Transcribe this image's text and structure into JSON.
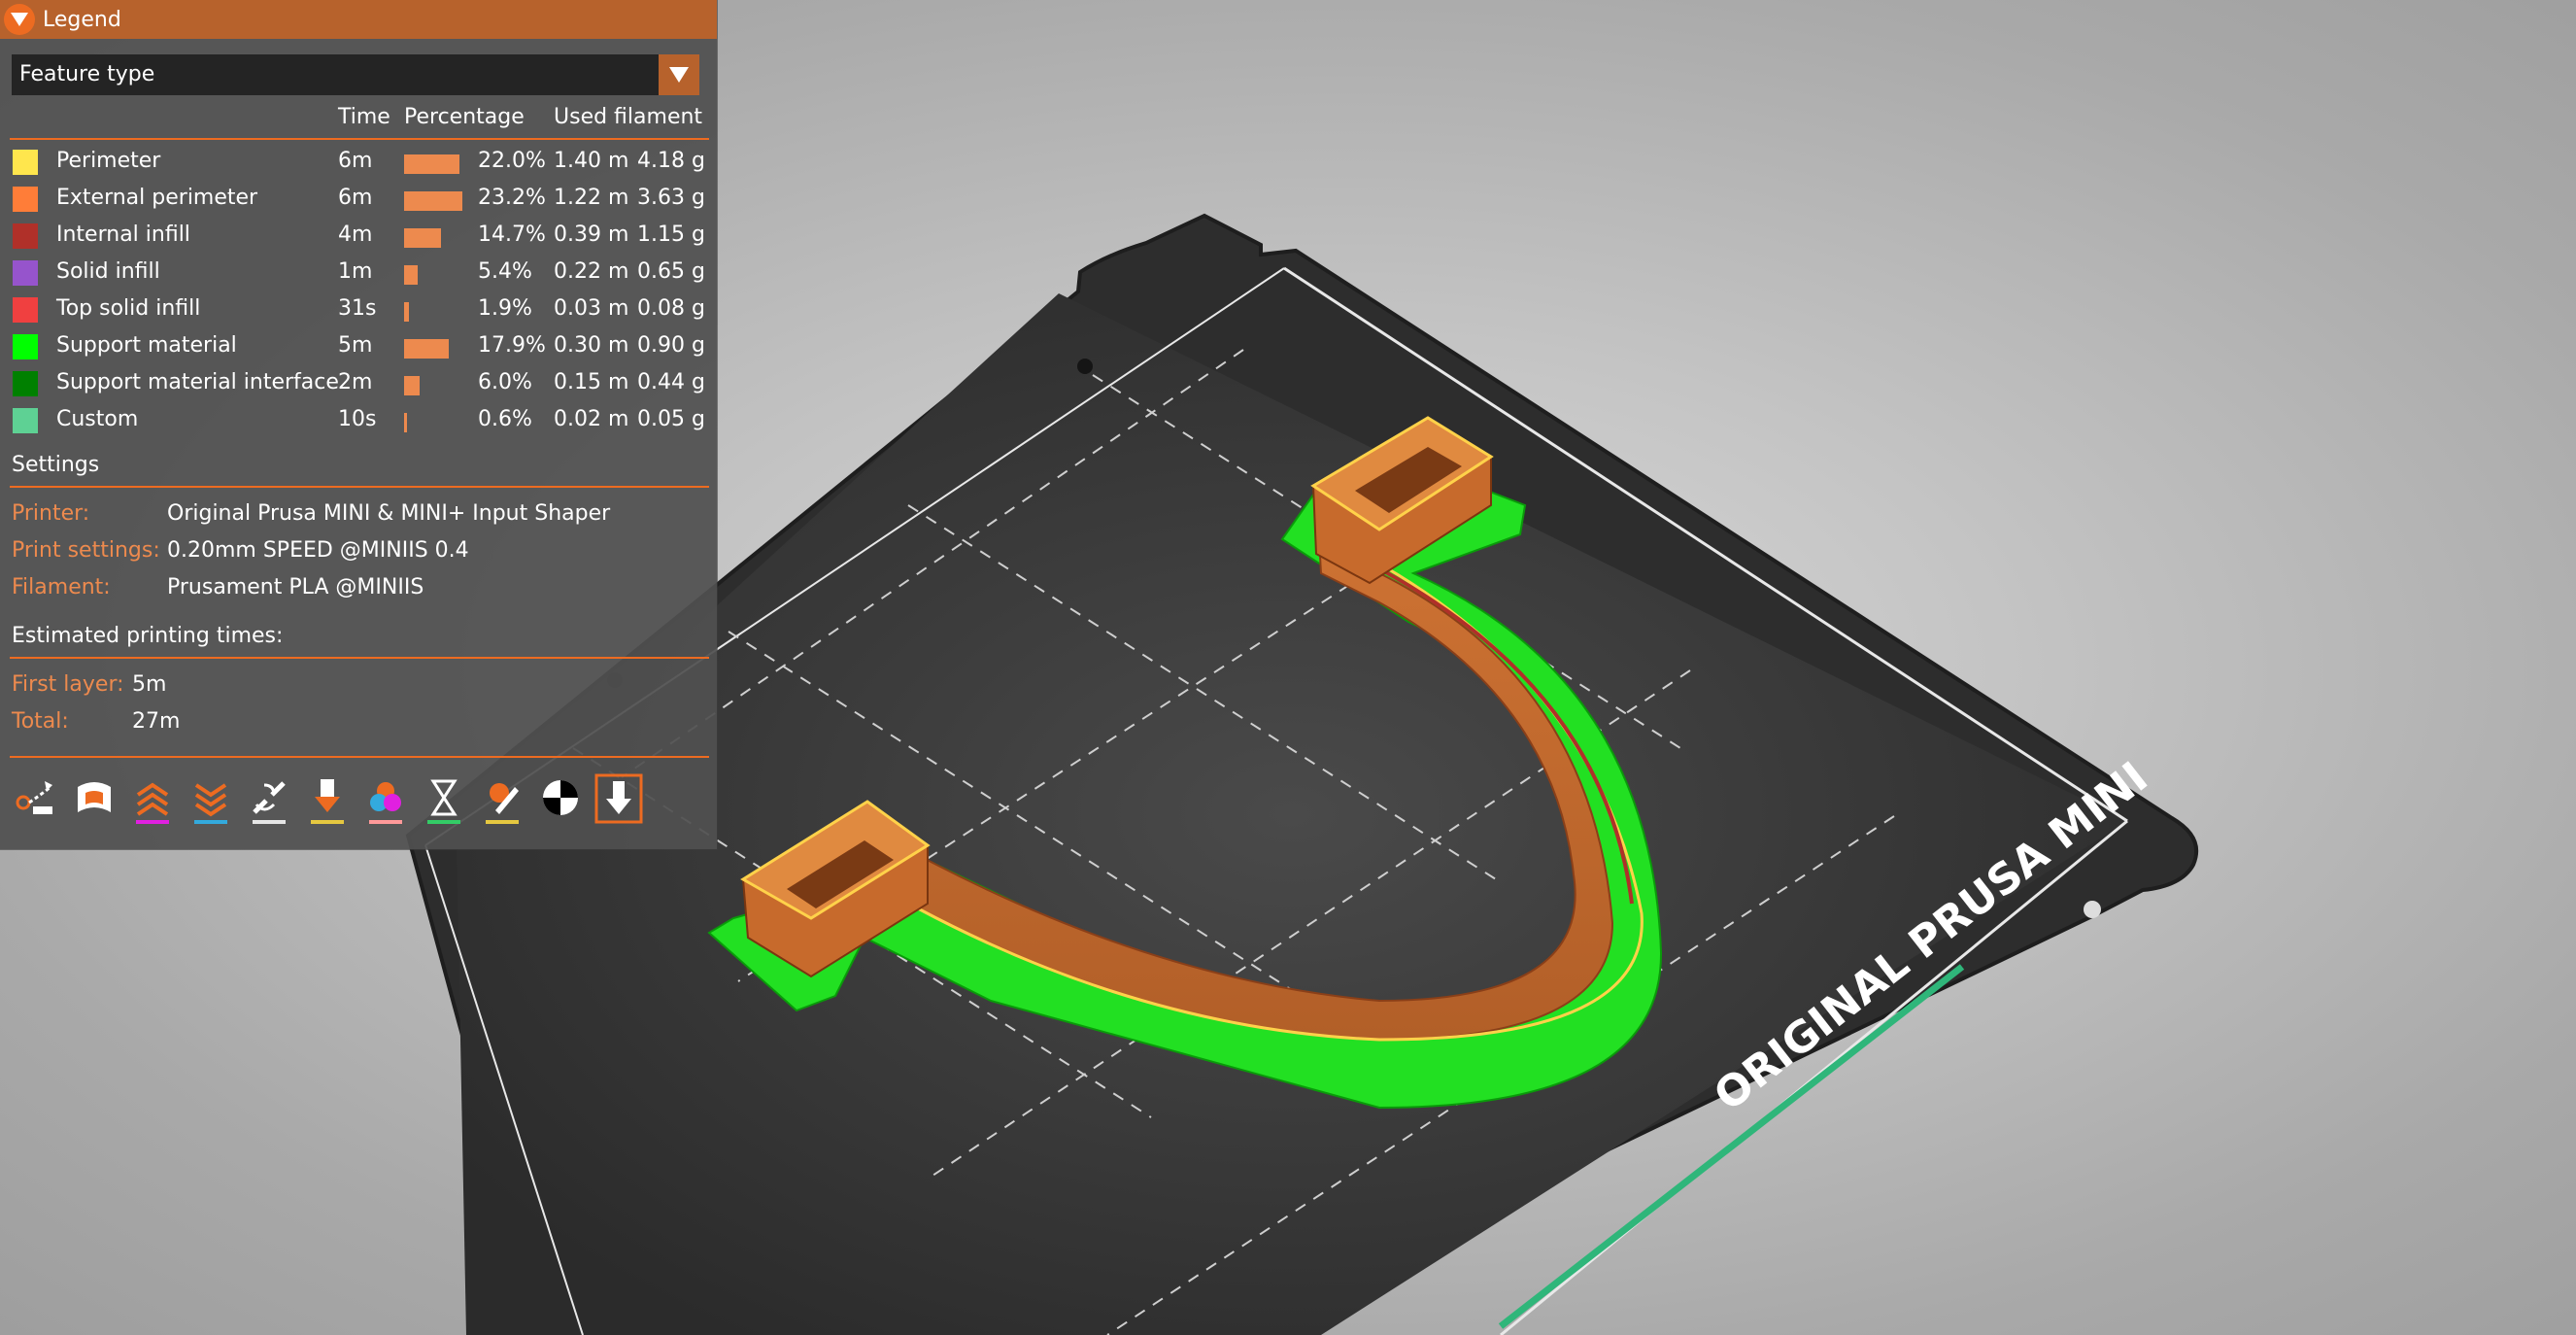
{
  "legend": {
    "title": "Legend",
    "view_type": "Feature type",
    "columns": {
      "time": "Time",
      "percentage": "Percentage",
      "used_filament": "Used filament"
    },
    "features": [
      {
        "name": "Perimeter",
        "time": "6m",
        "percentage": "22.0%",
        "length": "1.40 m",
        "weight": "4.18 g",
        "color": "#ffe64d",
        "fraction": 0.22
      },
      {
        "name": "External perimeter",
        "time": "6m",
        "percentage": "23.2%",
        "length": "1.22 m",
        "weight": "3.63 g",
        "color": "#ff7d38",
        "fraction": 0.232
      },
      {
        "name": "Internal infill",
        "time": "4m",
        "percentage": "14.7%",
        "length": "0.39 m",
        "weight": "1.15 g",
        "color": "#b03029",
        "fraction": 0.147
      },
      {
        "name": "Solid infill",
        "time": "1m",
        "percentage": "5.4%",
        "length": "0.22 m",
        "weight": "0.65 g",
        "color": "#9654cc",
        "fraction": 0.054
      },
      {
        "name": "Top solid infill",
        "time": "31s",
        "percentage": "1.9%",
        "length": "0.03 m",
        "weight": "0.08 g",
        "color": "#f04040",
        "fraction": 0.019
      },
      {
        "name": "Support material",
        "time": "5m",
        "percentage": "17.9%",
        "length": "0.30 m",
        "weight": "0.90 g",
        "color": "#00ff00",
        "fraction": 0.179
      },
      {
        "name": "Support material interface",
        "time": "2m",
        "percentage": "6.0%",
        "length": "0.15 m",
        "weight": "0.44 g",
        "color": "#008000",
        "fraction": 0.06
      },
      {
        "name": "Custom",
        "time": "10s",
        "percentage": "0.6%",
        "length": "0.02 m",
        "weight": "0.05 g",
        "color": "#5ed194",
        "fraction": 0.006
      }
    ],
    "settings": {
      "heading": "Settings",
      "printer_label": "Printer:",
      "printer": "Original Prusa MINI & MINI+ Input Shaper",
      "print_settings_label": "Print settings:",
      "print_settings": "0.20mm SPEED @MINIIS 0.4",
      "filament_label": "Filament:",
      "filament": "Prusament PLA @MINIIS"
    },
    "times": {
      "heading": "Estimated printing times:",
      "first_layer_label": "First layer:",
      "first_layer": "5m",
      "total_label": "Total:",
      "total": "27m"
    }
  },
  "toolbar": {
    "icons": [
      "travel-icon",
      "wipe-icon",
      "retractions-icon",
      "deretractions-icon",
      "seams-icon",
      "tool-changes-icon",
      "color-changes-icon",
      "pause-prints-icon",
      "custom-gcodes-icon",
      "center-of-gravity-icon",
      "tool-marker-icon"
    ]
  },
  "scene": {
    "bed_label": "ORIGINAL PRUSA MINI",
    "colors": {
      "accent": "#ed6b21",
      "bed": "#2b2b2b",
      "model": "#c4682c",
      "support": "#22e022"
    }
  }
}
